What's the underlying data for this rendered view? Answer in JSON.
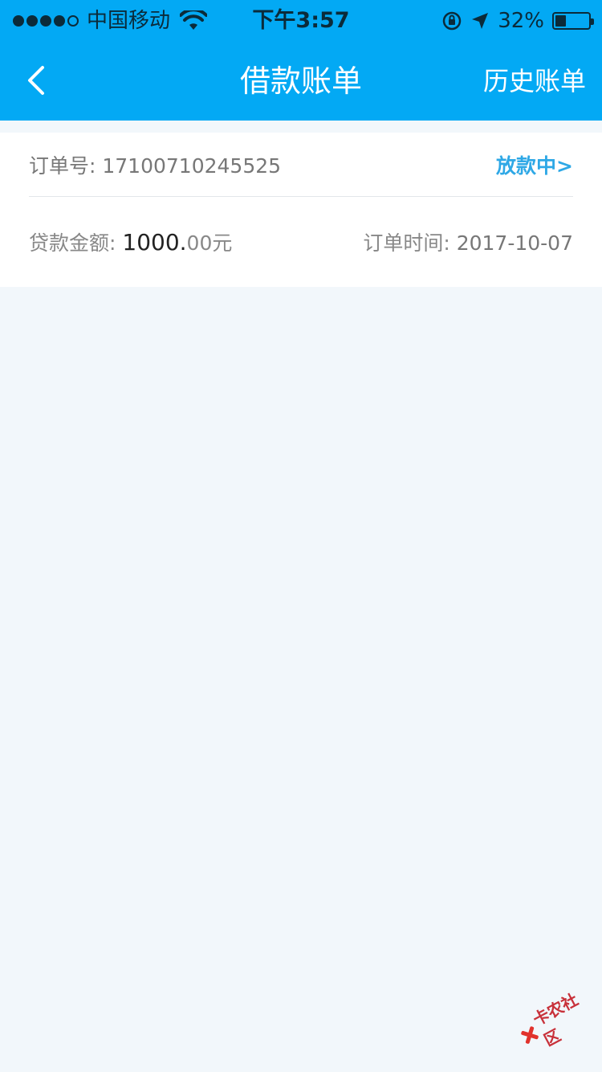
{
  "status_bar": {
    "carrier": "中国移动",
    "time": "下午3:57",
    "battery_percent": "32%",
    "battery_level": 0.32,
    "signal_filled": 4,
    "signal_total": 5
  },
  "nav": {
    "title": "借款账单",
    "right_label": "历史账单"
  },
  "order": {
    "number_label": "订单号: ",
    "number": "17100710245525",
    "status": "放款中>",
    "amount_label": "贷款金额: ",
    "amount_int": "1000.",
    "amount_dec": "00元",
    "time_label": "订单时间: ",
    "time": "2017-10-07"
  },
  "watermark": {
    "text": "卡农社区"
  },
  "colors": {
    "nav_bg": "#03a9f4",
    "page_bg": "#f2f7fb",
    "status_accent": "#2ea8e6"
  }
}
